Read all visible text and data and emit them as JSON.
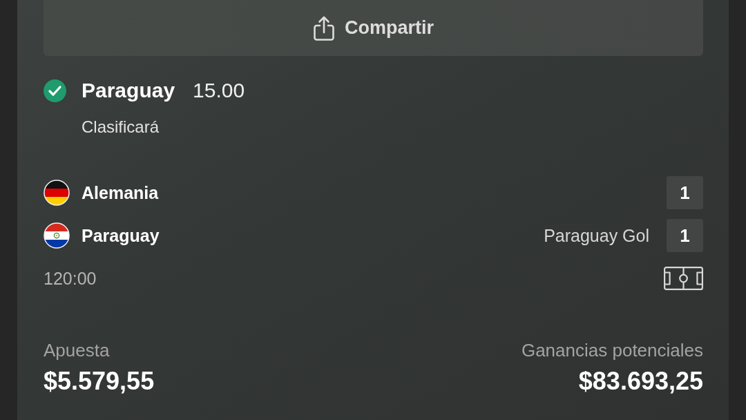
{
  "share_button": {
    "label": "Compartir"
  },
  "selection": {
    "won": true,
    "team": "Paraguay",
    "odds": "15.00",
    "market": "Clasificará"
  },
  "match": {
    "teams": [
      {
        "kind": "germany",
        "name": "Alemania",
        "score": "1"
      },
      {
        "kind": "paraguay",
        "name": "Paraguay",
        "event": "Paraguay Gol",
        "score": "1"
      }
    ],
    "time": "120:00"
  },
  "summary": {
    "stake_label": "Apuesta",
    "stake": "$5.579,55",
    "payout_label": "Ganancias potenciales",
    "payout": "$83.693,25"
  }
}
